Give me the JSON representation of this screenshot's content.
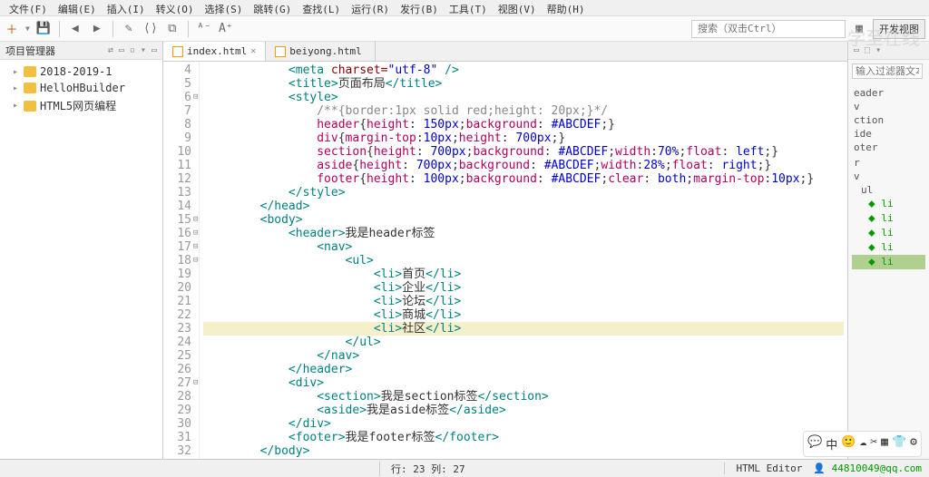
{
  "menu": [
    "文件(F)",
    "编辑(E)",
    "插入(I)",
    "转义(O)",
    "选择(S)",
    "跳转(G)",
    "查找(L)",
    "运行(R)",
    "发行(B)",
    "工具(T)",
    "视图(V)",
    "帮助(H)"
  ],
  "toolbar": {
    "search_placeholder": "搜索（双击Ctrl）",
    "btn_dev": "开发视图"
  },
  "sidebar": {
    "title": "项目管理器",
    "items": [
      "2018-2019-1",
      "HelloHBuilder",
      "HTML5网页编程"
    ]
  },
  "tabs": [
    {
      "label": "index.html",
      "active": true
    },
    {
      "label": "beiyong.html",
      "active": false
    }
  ],
  "outline": {
    "filter_ph": "输入过滤器文本",
    "items": [
      "eader",
      "v",
      "ction",
      "ide",
      "oter",
      "",
      "r",
      "v",
      "ul",
      "li",
      "li",
      "li",
      "li",
      "li"
    ],
    "selected": 13
  },
  "status": {
    "pos": "行: 23 列: 27",
    "mode": "HTML Editor",
    "user": "44810049@qq.com"
  },
  "watermark": "学至在线",
  "chart_data": {
    "type": "code-editor",
    "language": "html",
    "highlighted_line": 23,
    "lines": [
      {
        "n": 4,
        "indent": 3,
        "tokens": [
          [
            "tag",
            "<meta "
          ],
          [
            "attr",
            "charset="
          ],
          [
            "str",
            "\"utf-8\""
          ],
          [
            "tag",
            " />"
          ]
        ]
      },
      {
        "n": 5,
        "indent": 3,
        "tokens": [
          [
            "tag",
            "<title>"
          ],
          [
            "txt",
            "页面布局"
          ],
          [
            "tag",
            "</title>"
          ]
        ]
      },
      {
        "n": 6,
        "indent": 3,
        "fold": true,
        "tokens": [
          [
            "tag",
            "<style>"
          ]
        ]
      },
      {
        "n": 7,
        "indent": 4,
        "tokens": [
          [
            "cm",
            "/**{border:1px solid red;height: 20px;}*/"
          ]
        ]
      },
      {
        "n": 8,
        "indent": 4,
        "tokens": [
          [
            "prop",
            "header"
          ],
          [
            "txt",
            "{"
          ],
          [
            "prop",
            "height"
          ],
          [
            "txt",
            ": "
          ],
          [
            "val",
            "150px"
          ],
          [
            "txt",
            ";"
          ],
          [
            "prop",
            "background"
          ],
          [
            "txt",
            ": "
          ],
          [
            "val",
            "#ABCDEF"
          ],
          [
            "txt",
            ";}"
          ]
        ]
      },
      {
        "n": 9,
        "indent": 4,
        "tokens": [
          [
            "prop",
            "div"
          ],
          [
            "txt",
            "{"
          ],
          [
            "prop",
            "margin-top"
          ],
          [
            "txt",
            ":"
          ],
          [
            "val",
            "10px"
          ],
          [
            "txt",
            ";"
          ],
          [
            "prop",
            "height"
          ],
          [
            "txt",
            ": "
          ],
          [
            "val",
            "700px"
          ],
          [
            "txt",
            ";}"
          ]
        ]
      },
      {
        "n": 10,
        "indent": 4,
        "tokens": [
          [
            "prop",
            "section"
          ],
          [
            "txt",
            "{"
          ],
          [
            "prop",
            "height"
          ],
          [
            "txt",
            ": "
          ],
          [
            "val",
            "700px"
          ],
          [
            "txt",
            ";"
          ],
          [
            "prop",
            "background"
          ],
          [
            "txt",
            ": "
          ],
          [
            "val",
            "#ABCDEF"
          ],
          [
            "txt",
            ";"
          ],
          [
            "prop",
            "width"
          ],
          [
            "txt",
            ":"
          ],
          [
            "val",
            "70%"
          ],
          [
            "txt",
            ";"
          ],
          [
            "prop",
            "float"
          ],
          [
            "txt",
            ": "
          ],
          [
            "val",
            "left"
          ],
          [
            "txt",
            ";}"
          ]
        ]
      },
      {
        "n": 11,
        "indent": 4,
        "tokens": [
          [
            "prop",
            "aside"
          ],
          [
            "txt",
            "{"
          ],
          [
            "prop",
            "height"
          ],
          [
            "txt",
            ": "
          ],
          [
            "val",
            "700px"
          ],
          [
            "txt",
            ";"
          ],
          [
            "prop",
            "background"
          ],
          [
            "txt",
            ": "
          ],
          [
            "val",
            "#ABCDEF"
          ],
          [
            "txt",
            ";"
          ],
          [
            "prop",
            "width"
          ],
          [
            "txt",
            ":"
          ],
          [
            "val",
            "28%"
          ],
          [
            "txt",
            ";"
          ],
          [
            "prop",
            "float"
          ],
          [
            "txt",
            ": "
          ],
          [
            "val",
            "right"
          ],
          [
            "txt",
            ";}"
          ]
        ]
      },
      {
        "n": 12,
        "indent": 4,
        "tokens": [
          [
            "prop",
            "footer"
          ],
          [
            "txt",
            "{"
          ],
          [
            "prop",
            "height"
          ],
          [
            "txt",
            ": "
          ],
          [
            "val",
            "100px"
          ],
          [
            "txt",
            ";"
          ],
          [
            "prop",
            "background"
          ],
          [
            "txt",
            ": "
          ],
          [
            "val",
            "#ABCDEF"
          ],
          [
            "txt",
            ";"
          ],
          [
            "prop",
            "clear"
          ],
          [
            "txt",
            ": "
          ],
          [
            "val",
            "both"
          ],
          [
            "txt",
            ";"
          ],
          [
            "prop",
            "margin-top"
          ],
          [
            "txt",
            ":"
          ],
          [
            "val",
            "10px"
          ],
          [
            "txt",
            ";}"
          ]
        ]
      },
      {
        "n": 13,
        "indent": 3,
        "tokens": [
          [
            "tag",
            "</style>"
          ]
        ]
      },
      {
        "n": 14,
        "indent": 2,
        "tokens": [
          [
            "tag",
            "</head>"
          ]
        ]
      },
      {
        "n": 15,
        "indent": 2,
        "fold": true,
        "tokens": [
          [
            "tag",
            "<body>"
          ]
        ]
      },
      {
        "n": 16,
        "indent": 3,
        "fold": true,
        "tokens": [
          [
            "tag",
            "<header>"
          ],
          [
            "txt",
            "我是header标签"
          ]
        ]
      },
      {
        "n": 17,
        "indent": 4,
        "fold": true,
        "tokens": [
          [
            "tag",
            "<nav>"
          ]
        ]
      },
      {
        "n": 18,
        "indent": 5,
        "fold": true,
        "tokens": [
          [
            "tag",
            "<ul>"
          ]
        ]
      },
      {
        "n": 19,
        "indent": 6,
        "tokens": [
          [
            "tag",
            "<li>"
          ],
          [
            "txt",
            "首页"
          ],
          [
            "tag",
            "</li>"
          ]
        ]
      },
      {
        "n": 20,
        "indent": 6,
        "tokens": [
          [
            "tag",
            "<li>"
          ],
          [
            "txt",
            "企业"
          ],
          [
            "tag",
            "</li>"
          ]
        ]
      },
      {
        "n": 21,
        "indent": 6,
        "tokens": [
          [
            "tag",
            "<li>"
          ],
          [
            "txt",
            "论坛"
          ],
          [
            "tag",
            "</li>"
          ]
        ]
      },
      {
        "n": 22,
        "indent": 6,
        "tokens": [
          [
            "tag",
            "<li>"
          ],
          [
            "txt",
            "商城"
          ],
          [
            "tag",
            "</li>"
          ]
        ]
      },
      {
        "n": 23,
        "indent": 6,
        "hl": true,
        "tokens": [
          [
            "tag",
            "<li>"
          ],
          [
            "txt",
            "社区"
          ],
          [
            "tag",
            "</li>"
          ]
        ]
      },
      {
        "n": 24,
        "indent": 5,
        "tokens": [
          [
            "tag",
            "</ul>"
          ]
        ]
      },
      {
        "n": 25,
        "indent": 4,
        "tokens": [
          [
            "tag",
            "</nav>"
          ]
        ]
      },
      {
        "n": 26,
        "indent": 3,
        "tokens": [
          [
            "tag",
            "</header>"
          ]
        ]
      },
      {
        "n": 27,
        "indent": 3,
        "fold": true,
        "tokens": [
          [
            "tag",
            "<div>"
          ]
        ]
      },
      {
        "n": 28,
        "indent": 4,
        "tokens": [
          [
            "tag",
            "<section>"
          ],
          [
            "txt",
            "我是section标签"
          ],
          [
            "tag",
            "</section>"
          ]
        ]
      },
      {
        "n": 29,
        "indent": 4,
        "tokens": [
          [
            "tag",
            "<aside>"
          ],
          [
            "txt",
            "我是aside标签"
          ],
          [
            "tag",
            "</aside>"
          ]
        ]
      },
      {
        "n": 30,
        "indent": 3,
        "tokens": [
          [
            "tag",
            "</div>"
          ]
        ]
      },
      {
        "n": 31,
        "indent": 3,
        "tokens": [
          [
            "tag",
            "<footer>"
          ],
          [
            "txt",
            "我是footer标签"
          ],
          [
            "tag",
            "</footer>"
          ]
        ]
      },
      {
        "n": 32,
        "indent": 2,
        "tokens": [
          [
            "tag",
            "</body>"
          ]
        ]
      }
    ]
  }
}
